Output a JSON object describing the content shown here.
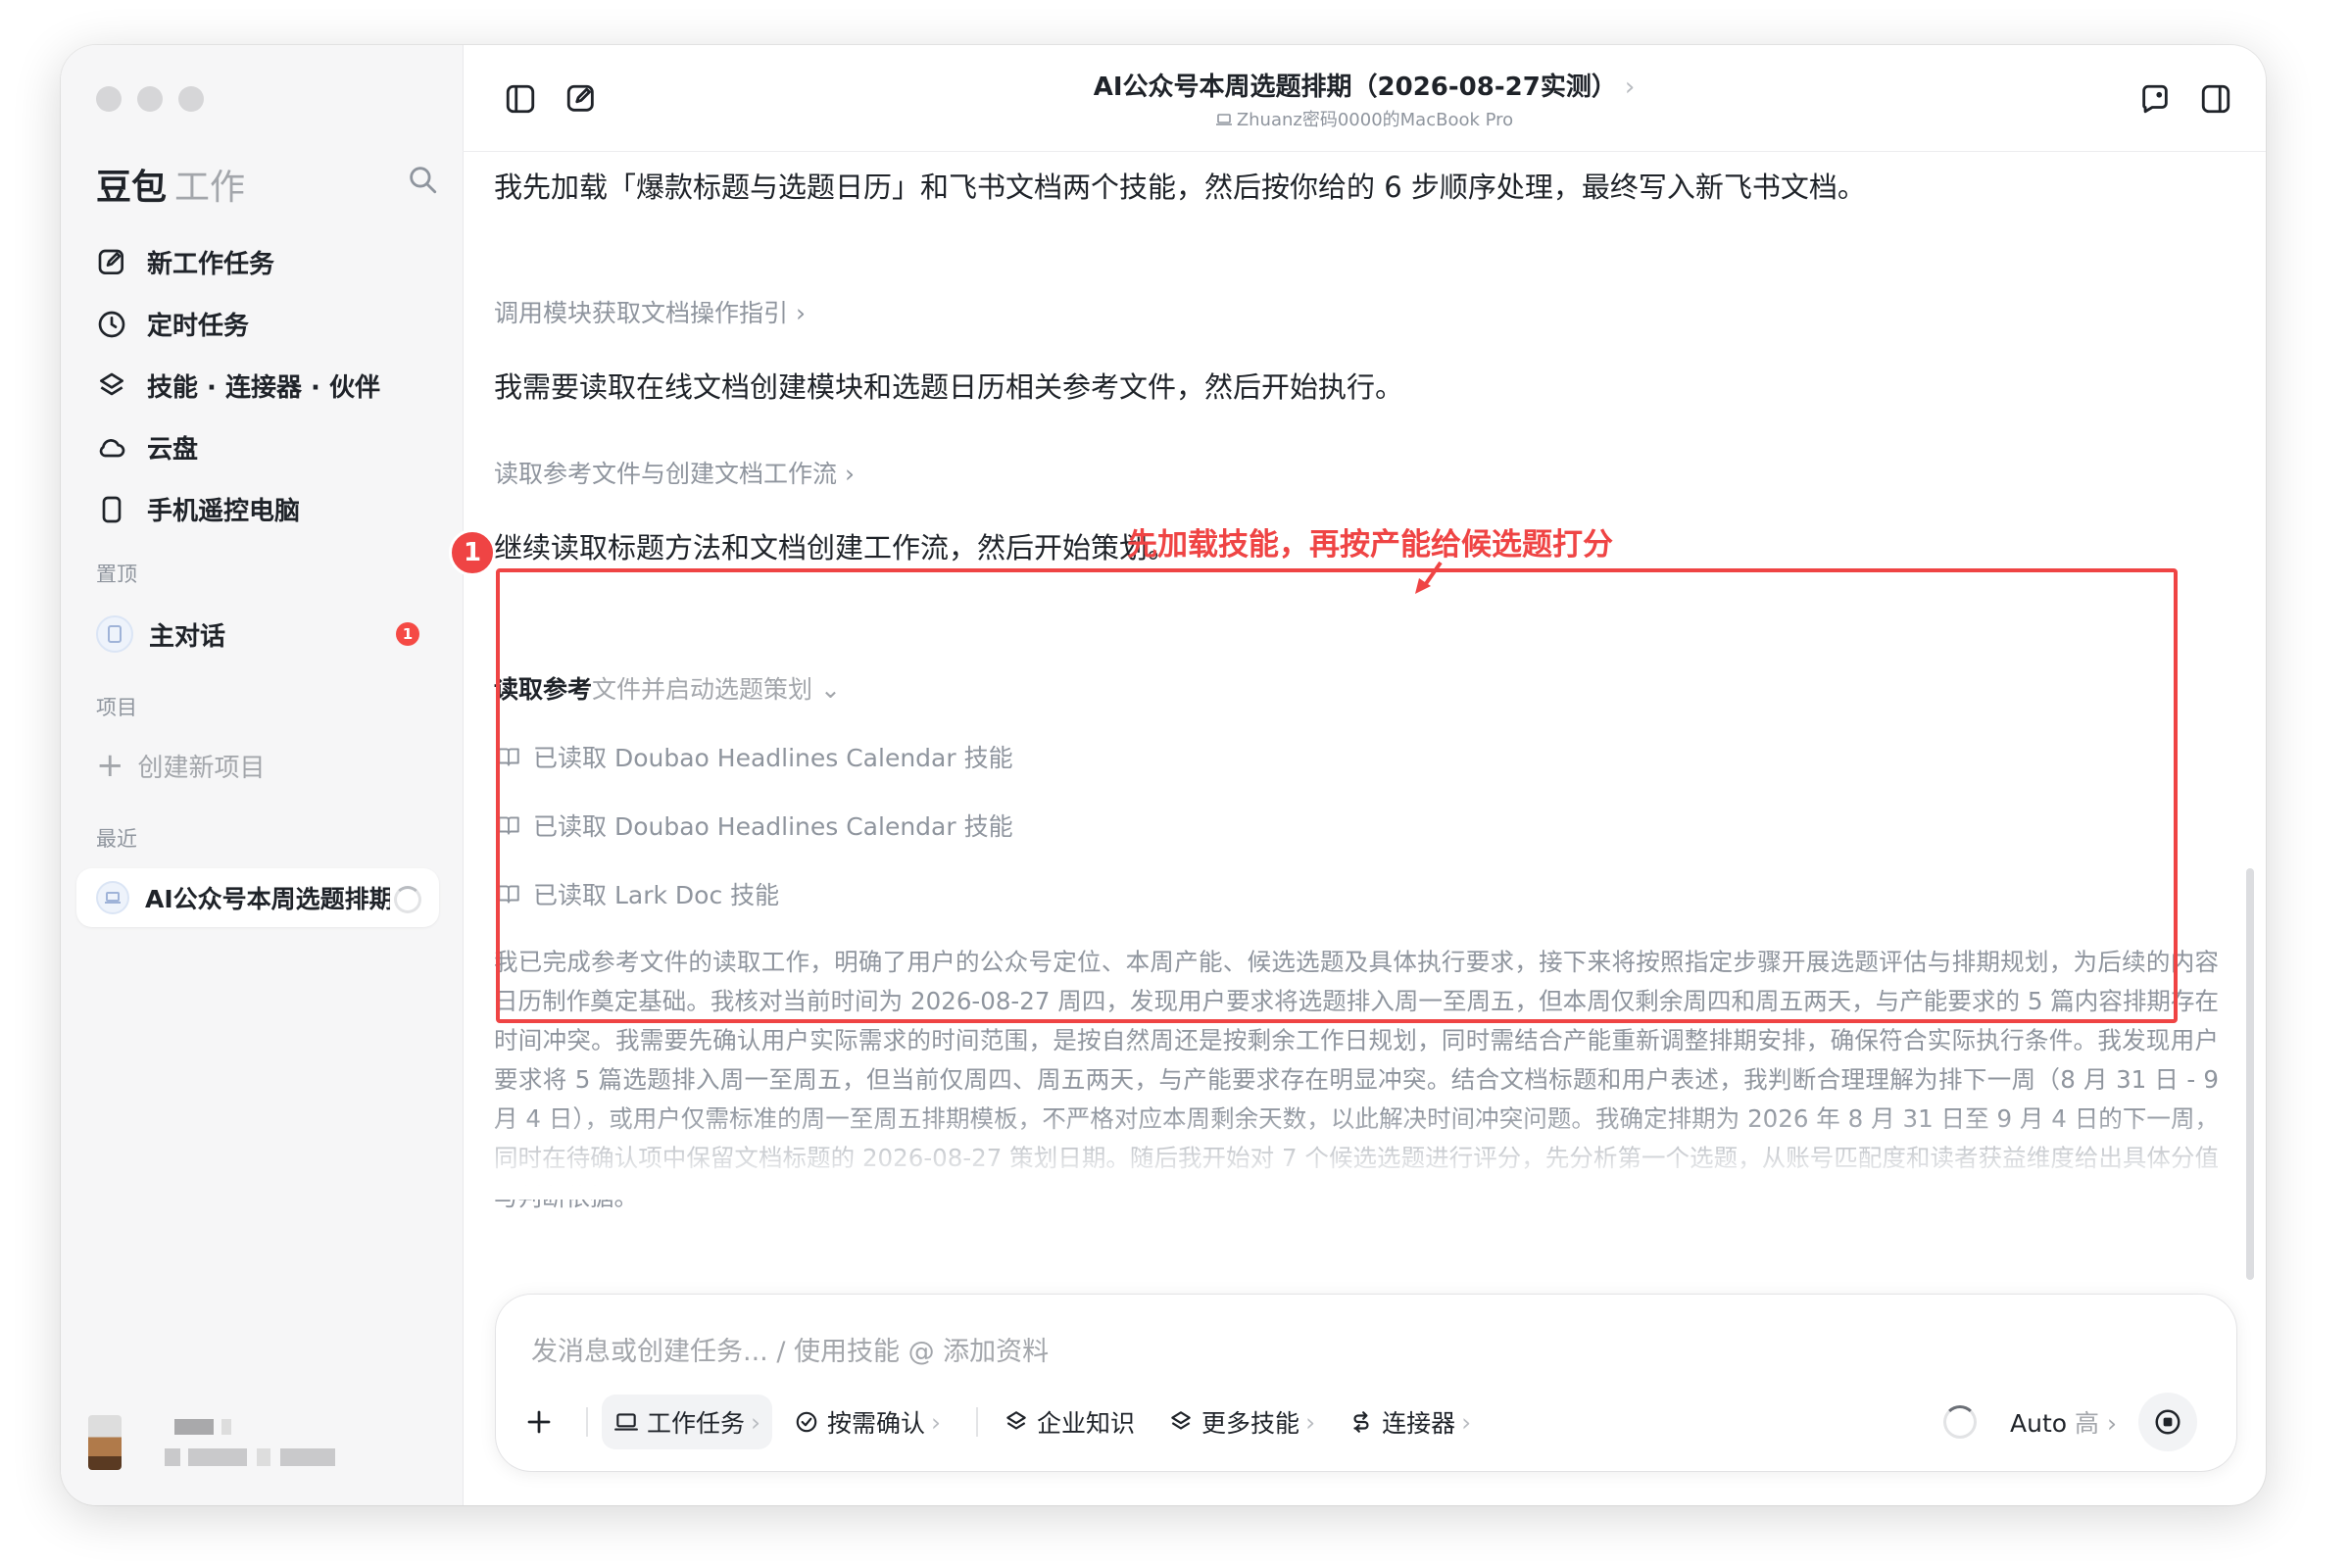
{
  "window": {
    "title": "AI公众号本周选题排期（2026-08-27实测）",
    "title_chevron": "›",
    "device": "Zhuanz密码0000的MacBook Pro"
  },
  "sidebar": {
    "brand": "豆包",
    "brand_sub": "工作",
    "nav": [
      {
        "label": "新工作任务",
        "icon": "edit-icon"
      },
      {
        "label": "定时任务",
        "icon": "clock-icon"
      },
      {
        "label": "技能 · 连接器 · 伙伴",
        "icon": "layers-icon"
      },
      {
        "label": "云盘",
        "icon": "cloud-icon"
      },
      {
        "label": "手机遥控电脑",
        "icon": "phone-icon"
      }
    ],
    "pinned_label": "置顶",
    "pinned_item": "主对话",
    "pinned_badge": "1",
    "projects_label": "项目",
    "create_project": "创建新项目",
    "recent_label": "最近",
    "recent_item": "AI公众号本周选题排期"
  },
  "conversation": {
    "para1": "我先加载「爆款标题与选题日历」和飞书文档两个技能，然后按你给的 6 步顺序处理，最终写入新飞书文档。",
    "link1": "调用模块获取文档操作指引 ›",
    "para2": "我需要读取在线文档创建模块和选题日历相关参考文件，然后开始执行。",
    "link2": "读取参考文件与创建文档工作流 ›",
    "para3": "继续读取标题方法和文档创建工作流，然后开始策划。",
    "step_title_dark": "读取参考",
    "step_title_grey": "文件并启动选题策划 ⌄",
    "skills": [
      "已读取 Doubao Headlines Calendar 技能",
      "已读取 Doubao Headlines Calendar 技能",
      "已读取 Lark Doc 技能"
    ],
    "reasoning": "我已完成参考文件的读取工作，明确了用户的公众号定位、本周产能、候选选题及具体执行要求，接下来将按照指定步骤开展选题评估与排期规划，为后续的内容日历制作奠定基础。我核对当前时间为 2026-08-27 周四，发现用户要求将选题排入周一至周五，但本周仅剩余周四和周五两天，与产能要求的 5 篇内容排期存在时间冲突。我需要先确认用户实际需求的时间范围，是按自然周还是按剩余工作日规划，同时需结合产能重新调整排期安排，确保符合实际执行条件。我发现用户要求将 5 篇选题排入周一至周五，但当前仅周四、周五两天，与产能要求存在明显冲突。结合文档标题和用户表述，我判断合理理解为排下一周（8 月 31 日 - 9 月 4 日），或用户仅需标准的周一至周五排期模板，不严格对应本周剩余天数，以此解决时间冲突问题。我确定排期为 2026 年 8 月 31 日至 9 月 4 日的下一周，同时在待确认项中保留文档标题的 2026-08-27 策划日期。随后我开始对 7 个候选选题进行评分，先分析第一个选题，从账号匹配度和读者获益维度给出具体分值与判断依据。"
  },
  "annotation": {
    "number": "1",
    "text": "先加载技能，再按产能给候选题打分",
    "color": "#ef4444"
  },
  "composer": {
    "placeholder": "发消息或创建任务... / 使用技能 @ 添加资料",
    "tools": [
      {
        "label": "工作任务",
        "icon": "laptop-icon",
        "chevron": true
      },
      {
        "label": "按需确认",
        "icon": "check-circle-icon",
        "chevron": true
      },
      {
        "label": "企业知识",
        "icon": "layers-icon",
        "chevron": false
      },
      {
        "label": "更多技能",
        "icon": "layers-icon",
        "chevron": true
      },
      {
        "label": "连接器",
        "icon": "link-icon",
        "chevron": true
      }
    ],
    "model": "Auto",
    "model_level": "高",
    "chevron": "›"
  }
}
